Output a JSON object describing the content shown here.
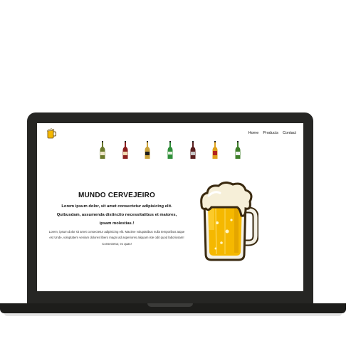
{
  "nav": {
    "items": [
      "Home",
      "Products",
      "Contact"
    ]
  },
  "hero": {
    "title": "MUNDO CERVEJEIRO",
    "lead": "Lorem ipsum dolor, sit amet consectetur adipisicing elit. Quibusdam, assumenda distinctio necessitatibus et maiores, ipsam molestias.!",
    "body": "Lorem, ipsum dolor sit amet consectetur adipisicing elit. Maxime voluptatibus nulla temporibus atque est Unde, voluptatem veniam dolores libero magni ad asperiores aliquam iste odit quod laboriosam! Consectetur, ex quas!"
  },
  "icons": {
    "logo": "beer-mug-icon",
    "hero_image": "beer-mug-illustration",
    "products": [
      "beer-bottle-icon",
      "beer-bottle-icon",
      "beer-bottle-icon",
      "beer-bottle-icon",
      "beer-bottle-icon",
      "beer-bottle-icon",
      "beer-bottle-icon"
    ]
  },
  "colors": {
    "frame": "#262624",
    "beer": "#f5b800",
    "foam": "#f6efd8",
    "bottles": [
      "#6b7a2c",
      "#8c1f1f",
      "#c9a23a",
      "#2f8f3a",
      "#5a1e1e",
      "#e0a21b",
      "#3f7f2a"
    ]
  }
}
